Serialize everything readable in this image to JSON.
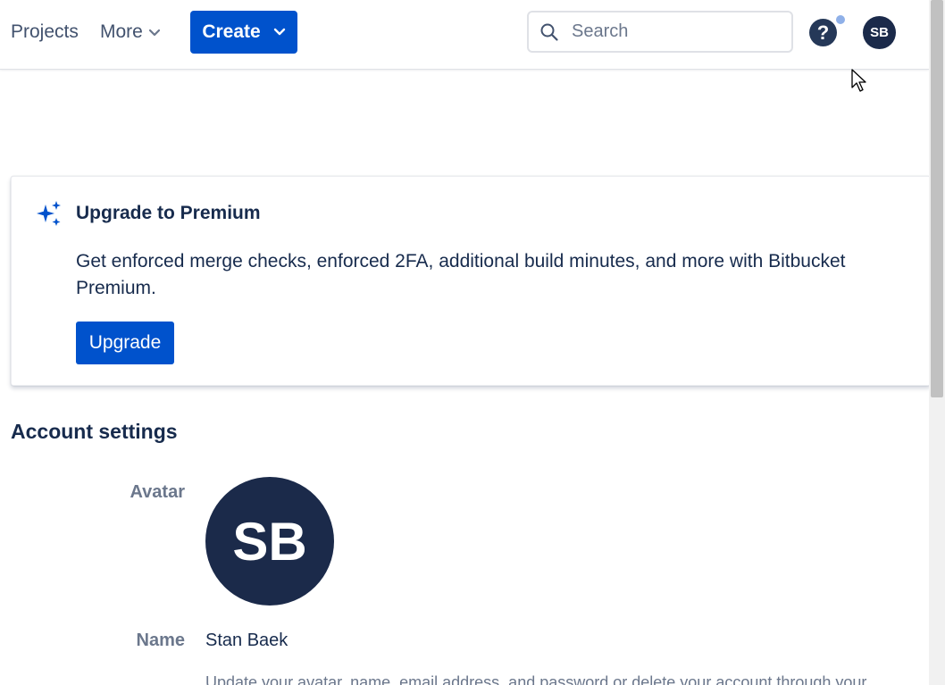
{
  "header": {
    "nav_projects": "Projects",
    "nav_more": "More",
    "create_label": "Create",
    "search_placeholder": "Search",
    "help_label": "?",
    "user_initials": "SB",
    "notification_color": "#8fb0e8"
  },
  "premium": {
    "title": "Upgrade to Premium",
    "description": "Get enforced merge checks, enforced 2FA, additional build minutes, and more with Bitbucket Premium.",
    "button_label": "Upgrade",
    "icon": "sparkle-icon",
    "accent_color": "#0052cc"
  },
  "account": {
    "section_title": "Account settings",
    "avatar_label": "Avatar",
    "avatar_initials": "SB",
    "name_label": "Name",
    "name_value": "Stan Baek",
    "helper_text": "Update your avatar, name, email address, and password or delete your account through your"
  },
  "icons": {
    "search": "search-icon",
    "chevron": "chevron-down-icon",
    "help": "help-icon",
    "cursor": "mouse-pointer-icon"
  },
  "colors": {
    "brand": "#0052cc",
    "text": "#172b4d",
    "subtle": "#6b778c",
    "avatar_bg": "#1b2a4a"
  }
}
